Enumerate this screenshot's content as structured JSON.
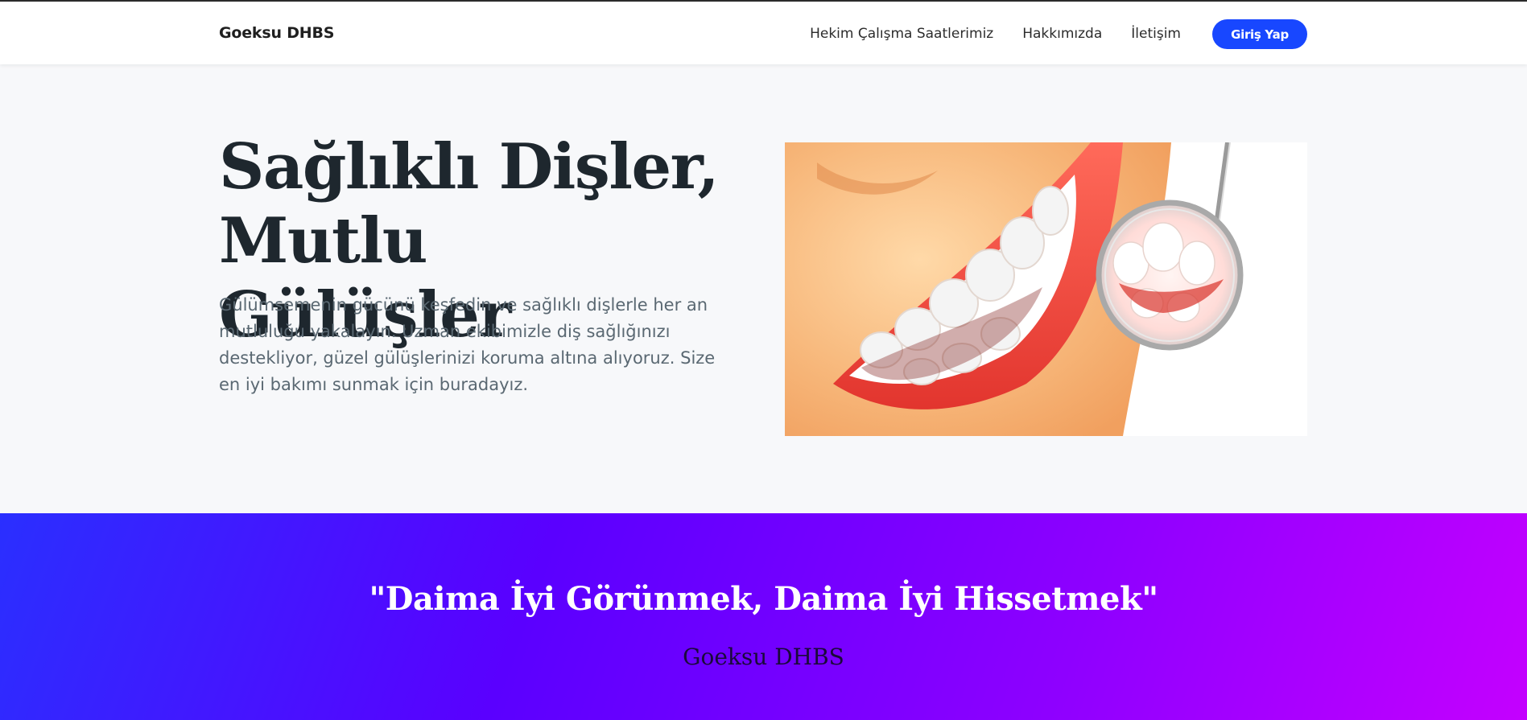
{
  "nav": {
    "brand": "Goeksu DHBS",
    "links": [
      "Hekim Çalışma Saatlerimiz",
      "Hakkımızda",
      "İletişim"
    ],
    "login_label": "Giriş Yap",
    "login_color": "#1847ff"
  },
  "hero": {
    "title_line1": "Sağlıklı Dişler,",
    "title_line2": "Mutlu Gülüşler",
    "text": "Gülümsemenin gücünü keşfedin ve sağlıklı dişlerle her an mutluluğu yakalayın. Uzman ekibimizle diş sağlığınızı destekliyor, güzel gülüşlerinizi koruma altına alıyoruz. Size en iyi bakımı sunmak için buradayız.",
    "image": "smiling-teeth-with-dental-mirror"
  },
  "quote": {
    "text": "\"Daima İyi Görünmek, Daima İyi Hissetmek\"",
    "author": "Goeksu DHBS",
    "gradient_start": "#2a2fff",
    "gradient_end": "#c400ff"
  }
}
